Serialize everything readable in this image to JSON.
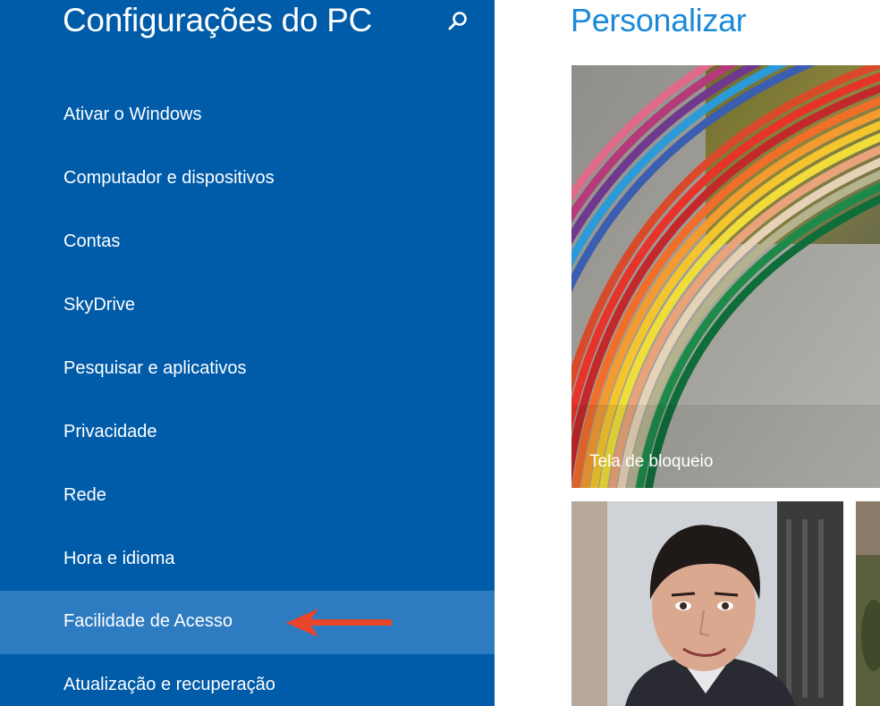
{
  "sidebar": {
    "title": "Configurações do PC",
    "search_icon": "search-icon",
    "background_color": "#005ba8",
    "selected_color": "#2d7bc0",
    "items": [
      {
        "label": "Ativar o Windows",
        "selected": false
      },
      {
        "label": "Computador e dispositivos",
        "selected": false
      },
      {
        "label": "Contas",
        "selected": false
      },
      {
        "label": "SkyDrive",
        "selected": false
      },
      {
        "label": "Pesquisar e aplicativos",
        "selected": false
      },
      {
        "label": "Privacidade",
        "selected": false
      },
      {
        "label": "Rede",
        "selected": false
      },
      {
        "label": "Hora e idioma",
        "selected": false
      },
      {
        "label": "Facilidade de Acesso",
        "selected": true
      },
      {
        "label": "Atualização e recuperação",
        "selected": false
      }
    ]
  },
  "annotation": {
    "arrow_icon": "arrow-left-icon",
    "color": "#e8452a"
  },
  "main": {
    "title": "Personalizar",
    "title_color": "#1a8ad8",
    "tiles": [
      {
        "label": "Tela de bloqueio",
        "image": "colored-paper-stack-photo"
      },
      {
        "label": "",
        "image": "account-portrait-photo"
      },
      {
        "label": "",
        "image": "third-tile-photo"
      }
    ]
  }
}
